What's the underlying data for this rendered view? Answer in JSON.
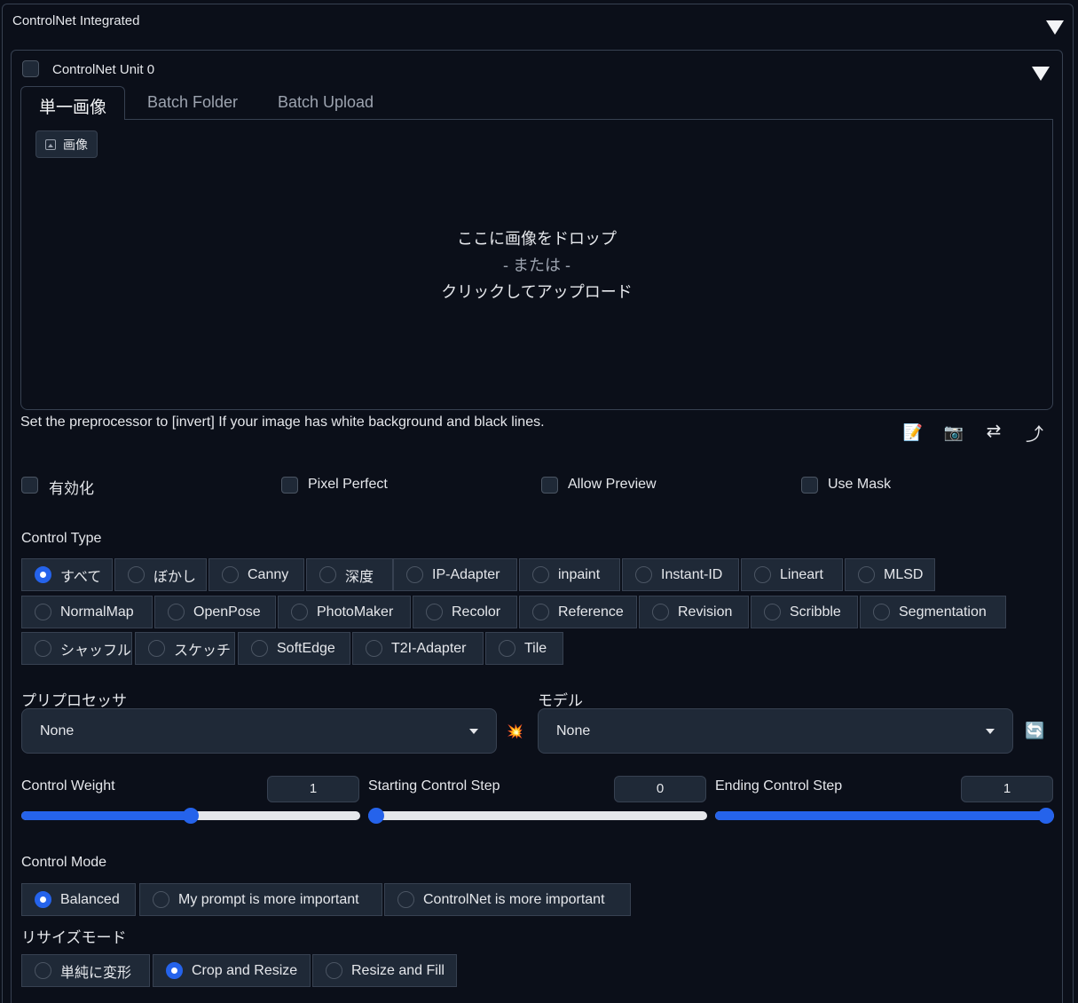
{
  "panel": {
    "title": "ControlNet Integrated",
    "unit_title": "ControlNet Unit 0"
  },
  "tabs": [
    {
      "label": "単一画像",
      "active": true
    },
    {
      "label": "Batch Folder",
      "active": false
    },
    {
      "label": "Batch Upload",
      "active": false
    }
  ],
  "upload": {
    "chip_label": "画像",
    "line1": "ここに画像をドロップ",
    "line2": "- または -",
    "line3": "クリックしてアップロード"
  },
  "hint": "Set the preprocessor to [invert] If your image has white background and black lines.",
  "tools": {
    "notes": "📝",
    "camera": "📷",
    "swap": "⇄",
    "send": "⤴"
  },
  "options": {
    "enable": "有効化",
    "pixel_perfect": "Pixel Perfect",
    "allow_preview": "Allow Preview",
    "use_mask": "Use Mask"
  },
  "control_type": {
    "label": "Control Type",
    "items": [
      "すべて",
      "ぼかし",
      "Canny",
      "深度",
      "IP-Adapter",
      "inpaint",
      "Instant-ID",
      "Lineart",
      "MLSD",
      "NormalMap",
      "OpenPose",
      "PhotoMaker",
      "Recolor",
      "Reference",
      "Revision",
      "Scribble",
      "Segmentation",
      "シャッフル",
      "スケッチ",
      "SoftEdge",
      "T2I-Adapter",
      "Tile"
    ],
    "selected": "すべて"
  },
  "preprocessor": {
    "label": "プリプロセッサ",
    "value": "None"
  },
  "run_icon": "💥",
  "model": {
    "label": "モデル",
    "value": "None"
  },
  "refresh_icon": "🔄",
  "sliders": {
    "weight": {
      "label": "Control Weight",
      "value": "1",
      "fraction": 0.5
    },
    "start": {
      "label": "Starting Control Step",
      "value": "0",
      "fraction": 0.0
    },
    "end": {
      "label": "Ending Control Step",
      "value": "1",
      "fraction": 1.0
    }
  },
  "control_mode": {
    "label": "Control Mode",
    "items": [
      "Balanced",
      "My prompt is more important",
      "ControlNet is more important"
    ],
    "selected": "Balanced"
  },
  "resize_mode": {
    "label": "リサイズモード",
    "items": [
      "単純に変形",
      "Crop and Resize",
      "Resize and Fill"
    ],
    "selected": "Crop and Resize"
  }
}
